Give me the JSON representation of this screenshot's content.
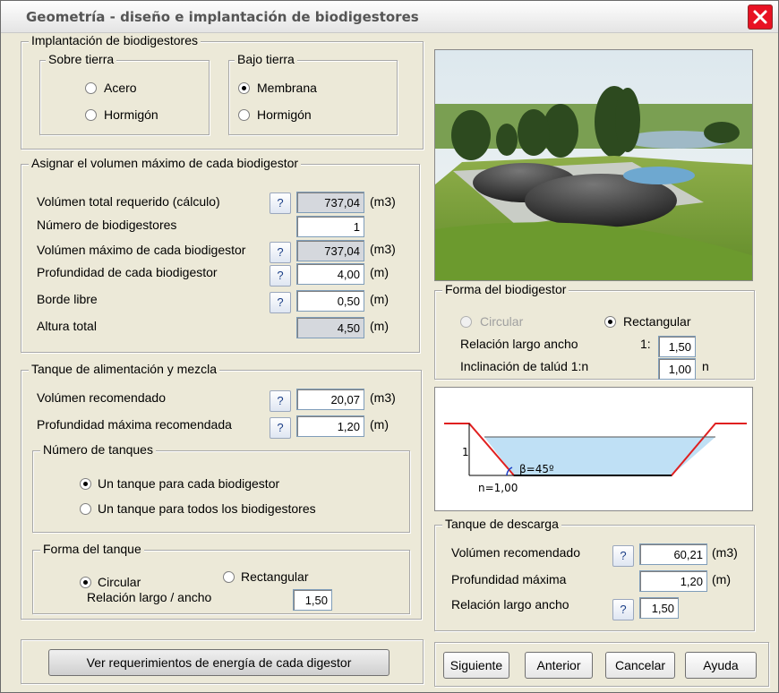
{
  "window": {
    "title": "Geometría  - diseño e implantación de biodigestores"
  },
  "implantacion": {
    "title": "Implantación de biodigestores",
    "sobre": {
      "title": "Sobre tierra",
      "acero": "Acero",
      "hormigon": "Hormigón"
    },
    "bajo": {
      "title": "Bajo tierra",
      "membrana": "Membrana",
      "hormigon": "Hormigón"
    }
  },
  "volumen": {
    "title": "Asignar el volumen máximo de cada biodigestor",
    "total_label": "Volúmen total requerido (cálculo)",
    "total_value": "737,04",
    "total_unit": "(m3)",
    "numero_label": "Número de biodigestores",
    "numero_value": "1",
    "maximo_label": "Volúmen máximo de cada biodigestor",
    "maximo_value": "737,04",
    "maximo_unit": "(m3)",
    "prof_label": "Profundidad de cada biodigestor",
    "prof_value": "4,00",
    "prof_unit": "(m)",
    "borde_label": "Borde libre",
    "borde_value": "0,50",
    "borde_unit": "(m)",
    "altura_label": "Altura total",
    "altura_value": "4,50",
    "altura_unit": "(m)",
    "help": "?"
  },
  "tanque": {
    "title": "Tanque de alimentación y mezcla",
    "vol_label": "Volúmen recomendado",
    "vol_value": "20,07",
    "vol_unit": "(m3)",
    "prof_label": "Profundidad máxima recomendada",
    "prof_value": "1,20",
    "prof_unit": "(m)",
    "numero": {
      "title": "Número de tanques",
      "uno": "Un tanque para cada biodigestor",
      "todos": "Un tanque para todos los biodigestores"
    },
    "forma": {
      "title": "Forma del tanque",
      "circular": "Circular",
      "rectangular": "Rectangular",
      "relacion_label": "Relación largo / ancho",
      "relacion_value": "1,50"
    }
  },
  "energia_button": "Ver requerimientos de energía de cada digestor",
  "forma_bio": {
    "title": "Forma del biodigestor",
    "circular": "Circular",
    "rectangular": "Rectangular",
    "relacion_label": "Relación largo ancho",
    "relacion_prefix": "1:",
    "relacion_value": "1,50",
    "talud_label": "Inclinación de talúd 1:n",
    "talud_value": "1,00",
    "talud_unit": "n"
  },
  "diagram": {
    "one": "1",
    "angle": "β=45º",
    "n": "n=1,00"
  },
  "descarga": {
    "title": "Tanque de descarga",
    "vol_label": "Volúmen recomendado",
    "vol_value": "60,21",
    "vol_unit": "(m3)",
    "prof_label": "Profundidad máxima",
    "prof_value": "1,20",
    "prof_unit": "(m)",
    "relacion_label": "Relación largo ancho",
    "relacion_value": "1,50"
  },
  "nav": {
    "siguiente": "Siguiente",
    "anterior": "Anterior",
    "cancelar": "Cancelar",
    "ayuda": "Ayuda"
  },
  "colors": {
    "accent_close": "#e81123",
    "diagram_water": "#bfe0f5",
    "diagram_slope": "#e02020"
  },
  "selected": {
    "implantacion": "membrana",
    "forma_bio": "rectangular",
    "numero_tanques": "uno",
    "forma_tanque": "circular"
  }
}
